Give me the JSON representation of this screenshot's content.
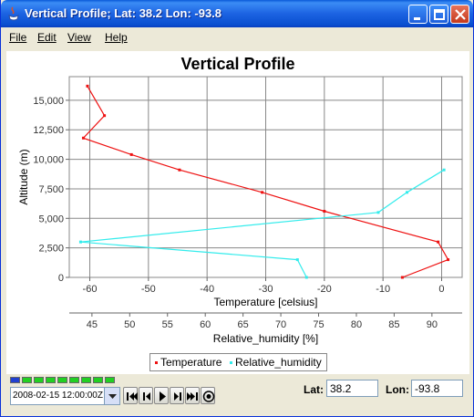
{
  "window": {
    "title": "Vertical Profile; Lat: 38.2 Lon: -93.8"
  },
  "menu": {
    "items": [
      "File",
      "Edit",
      "View",
      "Help"
    ]
  },
  "chart_data": {
    "type": "line",
    "title": "Vertical Profile",
    "ylabel": "Altitude (m)",
    "xlabel": "Temperature [celsius]",
    "xlabel2": "Relative_humidity [%]",
    "ylim": [
      0,
      17000
    ],
    "xlim": [
      -63.5,
      3.5
    ],
    "x2lim": [
      42,
      94
    ],
    "yticks": [
      {
        "v": 0,
        "label": "0"
      },
      {
        "v": 2500,
        "label": "2,500"
      },
      {
        "v": 5000,
        "label": "5,000"
      },
      {
        "v": 7500,
        "label": "7,500"
      },
      {
        "v": 10000,
        "label": "10,000"
      },
      {
        "v": 12500,
        "label": "12,500"
      },
      {
        "v": 15000,
        "label": "15,000"
      }
    ],
    "xticks": [
      {
        "v": -60,
        "label": "-60"
      },
      {
        "v": -50,
        "label": "-50"
      },
      {
        "v": -40,
        "label": "-40"
      },
      {
        "v": -30,
        "label": "-30"
      },
      {
        "v": -20,
        "label": "-20"
      },
      {
        "v": -10,
        "label": "-10"
      },
      {
        "v": 0,
        "label": "0"
      }
    ],
    "x2ticks": [
      {
        "v": 45,
        "label": "45"
      },
      {
        "v": 50,
        "label": "50"
      },
      {
        "v": 55,
        "label": "55"
      },
      {
        "v": 60,
        "label": "60"
      },
      {
        "v": 65,
        "label": "65"
      },
      {
        "v": 70,
        "label": "70"
      },
      {
        "v": 75,
        "label": "75"
      },
      {
        "v": 80,
        "label": "80"
      },
      {
        "v": 85,
        "label": "85"
      },
      {
        "v": 90,
        "label": "90"
      }
    ],
    "grid": true,
    "series": [
      {
        "name": "Temperature",
        "color": "#ee1111",
        "axis": "x",
        "points": [
          {
            "x": -6.7,
            "y": 0
          },
          {
            "x": 1.1,
            "y": 1500
          },
          {
            "x": -0.6,
            "y": 3000
          },
          {
            "x": -20.0,
            "y": 5600
          },
          {
            "x": -30.6,
            "y": 7200
          },
          {
            "x": -44.7,
            "y": 9100
          },
          {
            "x": -52.9,
            "y": 10400
          },
          {
            "x": -61.1,
            "y": 11800
          },
          {
            "x": -57.5,
            "y": 13700
          },
          {
            "x": -60.4,
            "y": 16200
          }
        ]
      },
      {
        "name": "Relative_humidity",
        "color": "#33ecec",
        "axis": "x2",
        "points": [
          {
            "x": 73.4,
            "y": 0
          },
          {
            "x": 72.2,
            "y": 1500
          },
          {
            "x": 43.5,
            "y": 3000
          },
          {
            "x": 82.9,
            "y": 5500
          },
          {
            "x": 86.7,
            "y": 7200
          },
          {
            "x": 91.6,
            "y": 9100
          }
        ]
      }
    ]
  },
  "legend": {
    "items": [
      "Temperature",
      "Relative_humidity"
    ]
  },
  "time": {
    "date": "2008-02-15 12:00:00Z",
    "steps_active": 1,
    "steps_total": 9
  },
  "coords": {
    "lat_label": "Lat:",
    "lat_value": "38.2",
    "lon_label": "Lon:",
    "lon_value": "-93.8"
  }
}
